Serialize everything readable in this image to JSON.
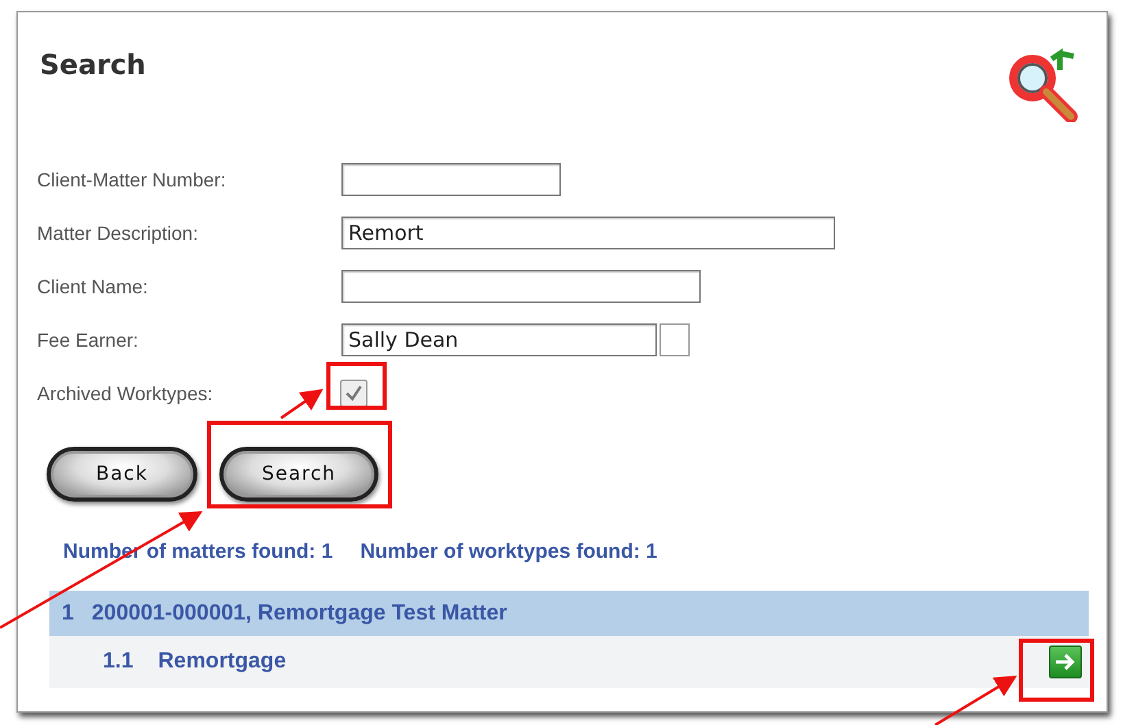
{
  "title": "Search",
  "fields": [
    {
      "label": "Client-Matter Number:",
      "kind": "text"
    },
    {
      "label": "Matter Description:",
      "kind": "text",
      "value": "Remort"
    },
    {
      "label": "Client Name:",
      "kind": "text"
    },
    {
      "label": "Fee Earner:",
      "kind": "lookup",
      "value": "Sally Dean"
    },
    {
      "label": "Archived Worktypes:",
      "kind": "checkbox",
      "checked": true
    }
  ],
  "buttons": [
    "Back",
    "Search"
  ],
  "summary": [
    "Number of matters found: 1",
    "Number of worktypes found: 1"
  ],
  "results": [
    {
      "number": "1",
      "text": "200001-000001, Remortgage Test Matter",
      "children": [
        {
          "number": "1.1",
          "text": "Remortgage"
        }
      ]
    }
  ]
}
